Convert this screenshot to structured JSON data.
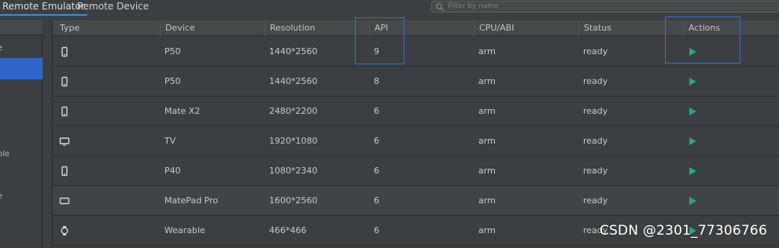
{
  "tabs": [
    {
      "label": "Remote Emulator",
      "active": true
    },
    {
      "label": "Remote Device",
      "active": false
    }
  ],
  "search": {
    "placeholder": "Filter by name",
    "value": ""
  },
  "sidebar": {
    "items": [
      {
        "label": "e"
      },
      {
        "label": "",
        "selected": true
      },
      {
        "label": "ble"
      },
      {
        "label": "e"
      }
    ]
  },
  "table": {
    "columns": [
      "Type",
      "Device",
      "Resolution",
      "API",
      "CPU/ABI",
      "Status",
      "Actions"
    ],
    "rows": [
      {
        "type_icon": "phone-icon",
        "device": "P50",
        "resolution": "1440*2560",
        "api": "9",
        "cpu": "arm",
        "status": "ready",
        "action_icon": "play-icon"
      },
      {
        "type_icon": "phone-icon",
        "device": "P50",
        "resolution": "1440*2560",
        "api": "8",
        "cpu": "arm",
        "status": "ready",
        "action_icon": "play-icon"
      },
      {
        "type_icon": "phone-icon",
        "device": "Mate X2",
        "resolution": "2480*2200",
        "api": "6",
        "cpu": "arm",
        "status": "ready",
        "action_icon": "play-icon"
      },
      {
        "type_icon": "tv-icon",
        "device": "TV",
        "resolution": "1920*1080",
        "api": "6",
        "cpu": "arm",
        "status": "ready",
        "action_icon": "play-icon"
      },
      {
        "type_icon": "phone-icon",
        "device": "P40",
        "resolution": "1080*2340",
        "api": "6",
        "cpu": "arm",
        "status": "ready",
        "action_icon": "play-icon"
      },
      {
        "type_icon": "tablet-icon",
        "device": "MatePad Pro",
        "resolution": "1600*2560",
        "api": "6",
        "cpu": "arm",
        "status": "ready",
        "action_icon": "play-icon"
      },
      {
        "type_icon": "watch-icon",
        "device": "Wearable",
        "resolution": "466*466",
        "api": "6",
        "cpu": "arm",
        "status": "ready",
        "action_icon": "play-icon"
      }
    ]
  },
  "colors": {
    "background": "#3c3f41",
    "accent": "#2f65ca",
    "play": "#2aa198",
    "highlight": "#2f6fe0"
  },
  "watermark": "CSDN @2301_77306766"
}
